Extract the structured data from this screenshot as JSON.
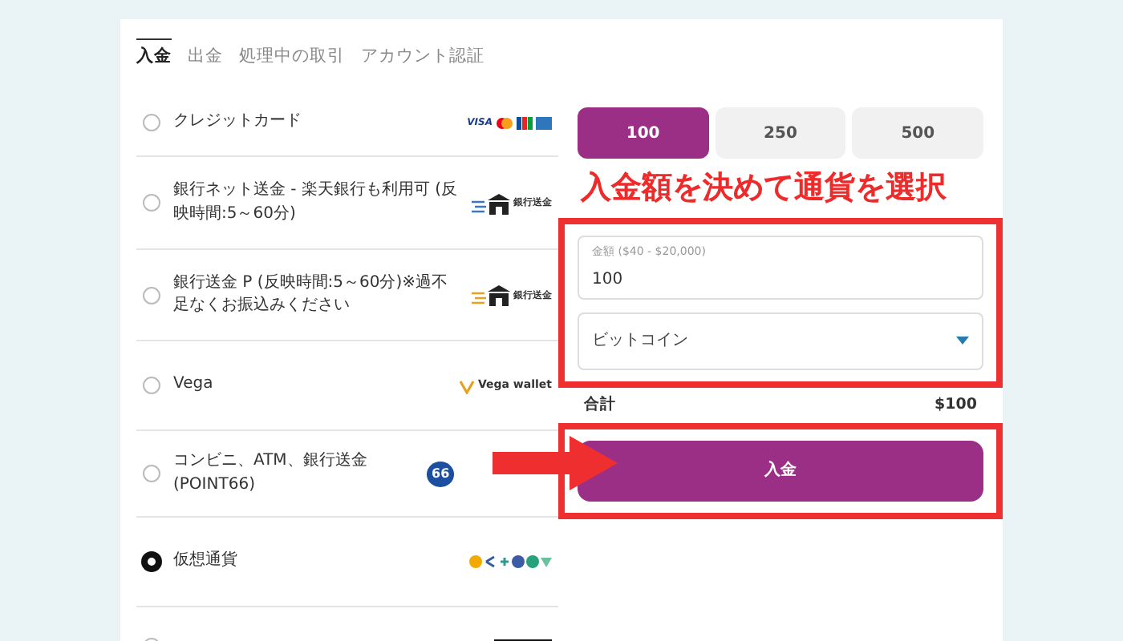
{
  "tabs": [
    {
      "label": "入金",
      "selected": true
    },
    {
      "label": "出金",
      "selected": false
    },
    {
      "label": "処理中の取引",
      "selected": false
    },
    {
      "label": "アカウント認証",
      "selected": false
    }
  ],
  "payment_methods": [
    {
      "label": "クレジットカード",
      "selected": false,
      "kind": "cards",
      "logo_text": "VISA"
    },
    {
      "label": "銀行ネット送金 - 楽天銀行も利用可 (反映時間:5～60分)",
      "selected": false,
      "kind": "banknet",
      "logo_text": "銀行送金"
    },
    {
      "label": "銀行送金 P (反映時間:5～60分)※過不足なくお振込みください",
      "selected": false,
      "kind": "bank",
      "logo_text": "銀行送金"
    },
    {
      "label": "Vega",
      "selected": false,
      "kind": "vega",
      "logo_text": "Vega wallet"
    },
    {
      "label": "コンビニ、ATM、銀行送金 (POINT66)",
      "selected": false,
      "kind": "point",
      "logo_text": "66"
    },
    {
      "label": "仮想通貨",
      "selected": true,
      "kind": "crypto"
    },
    {
      "selected": false,
      "kind": "partial"
    }
  ],
  "amount_buttons": [
    {
      "label": "100",
      "selected": true
    },
    {
      "label": "250",
      "selected": false
    },
    {
      "label": "500",
      "selected": false
    }
  ],
  "amount_field": {
    "label": "金額 ($40 - $20,000)",
    "value": "100"
  },
  "currency_select": {
    "value": "ビットコイン"
  },
  "total": {
    "label": "合計",
    "value": "$100"
  },
  "deposit_button": "入金",
  "annotation": "入金額を決めて通貨を選択"
}
